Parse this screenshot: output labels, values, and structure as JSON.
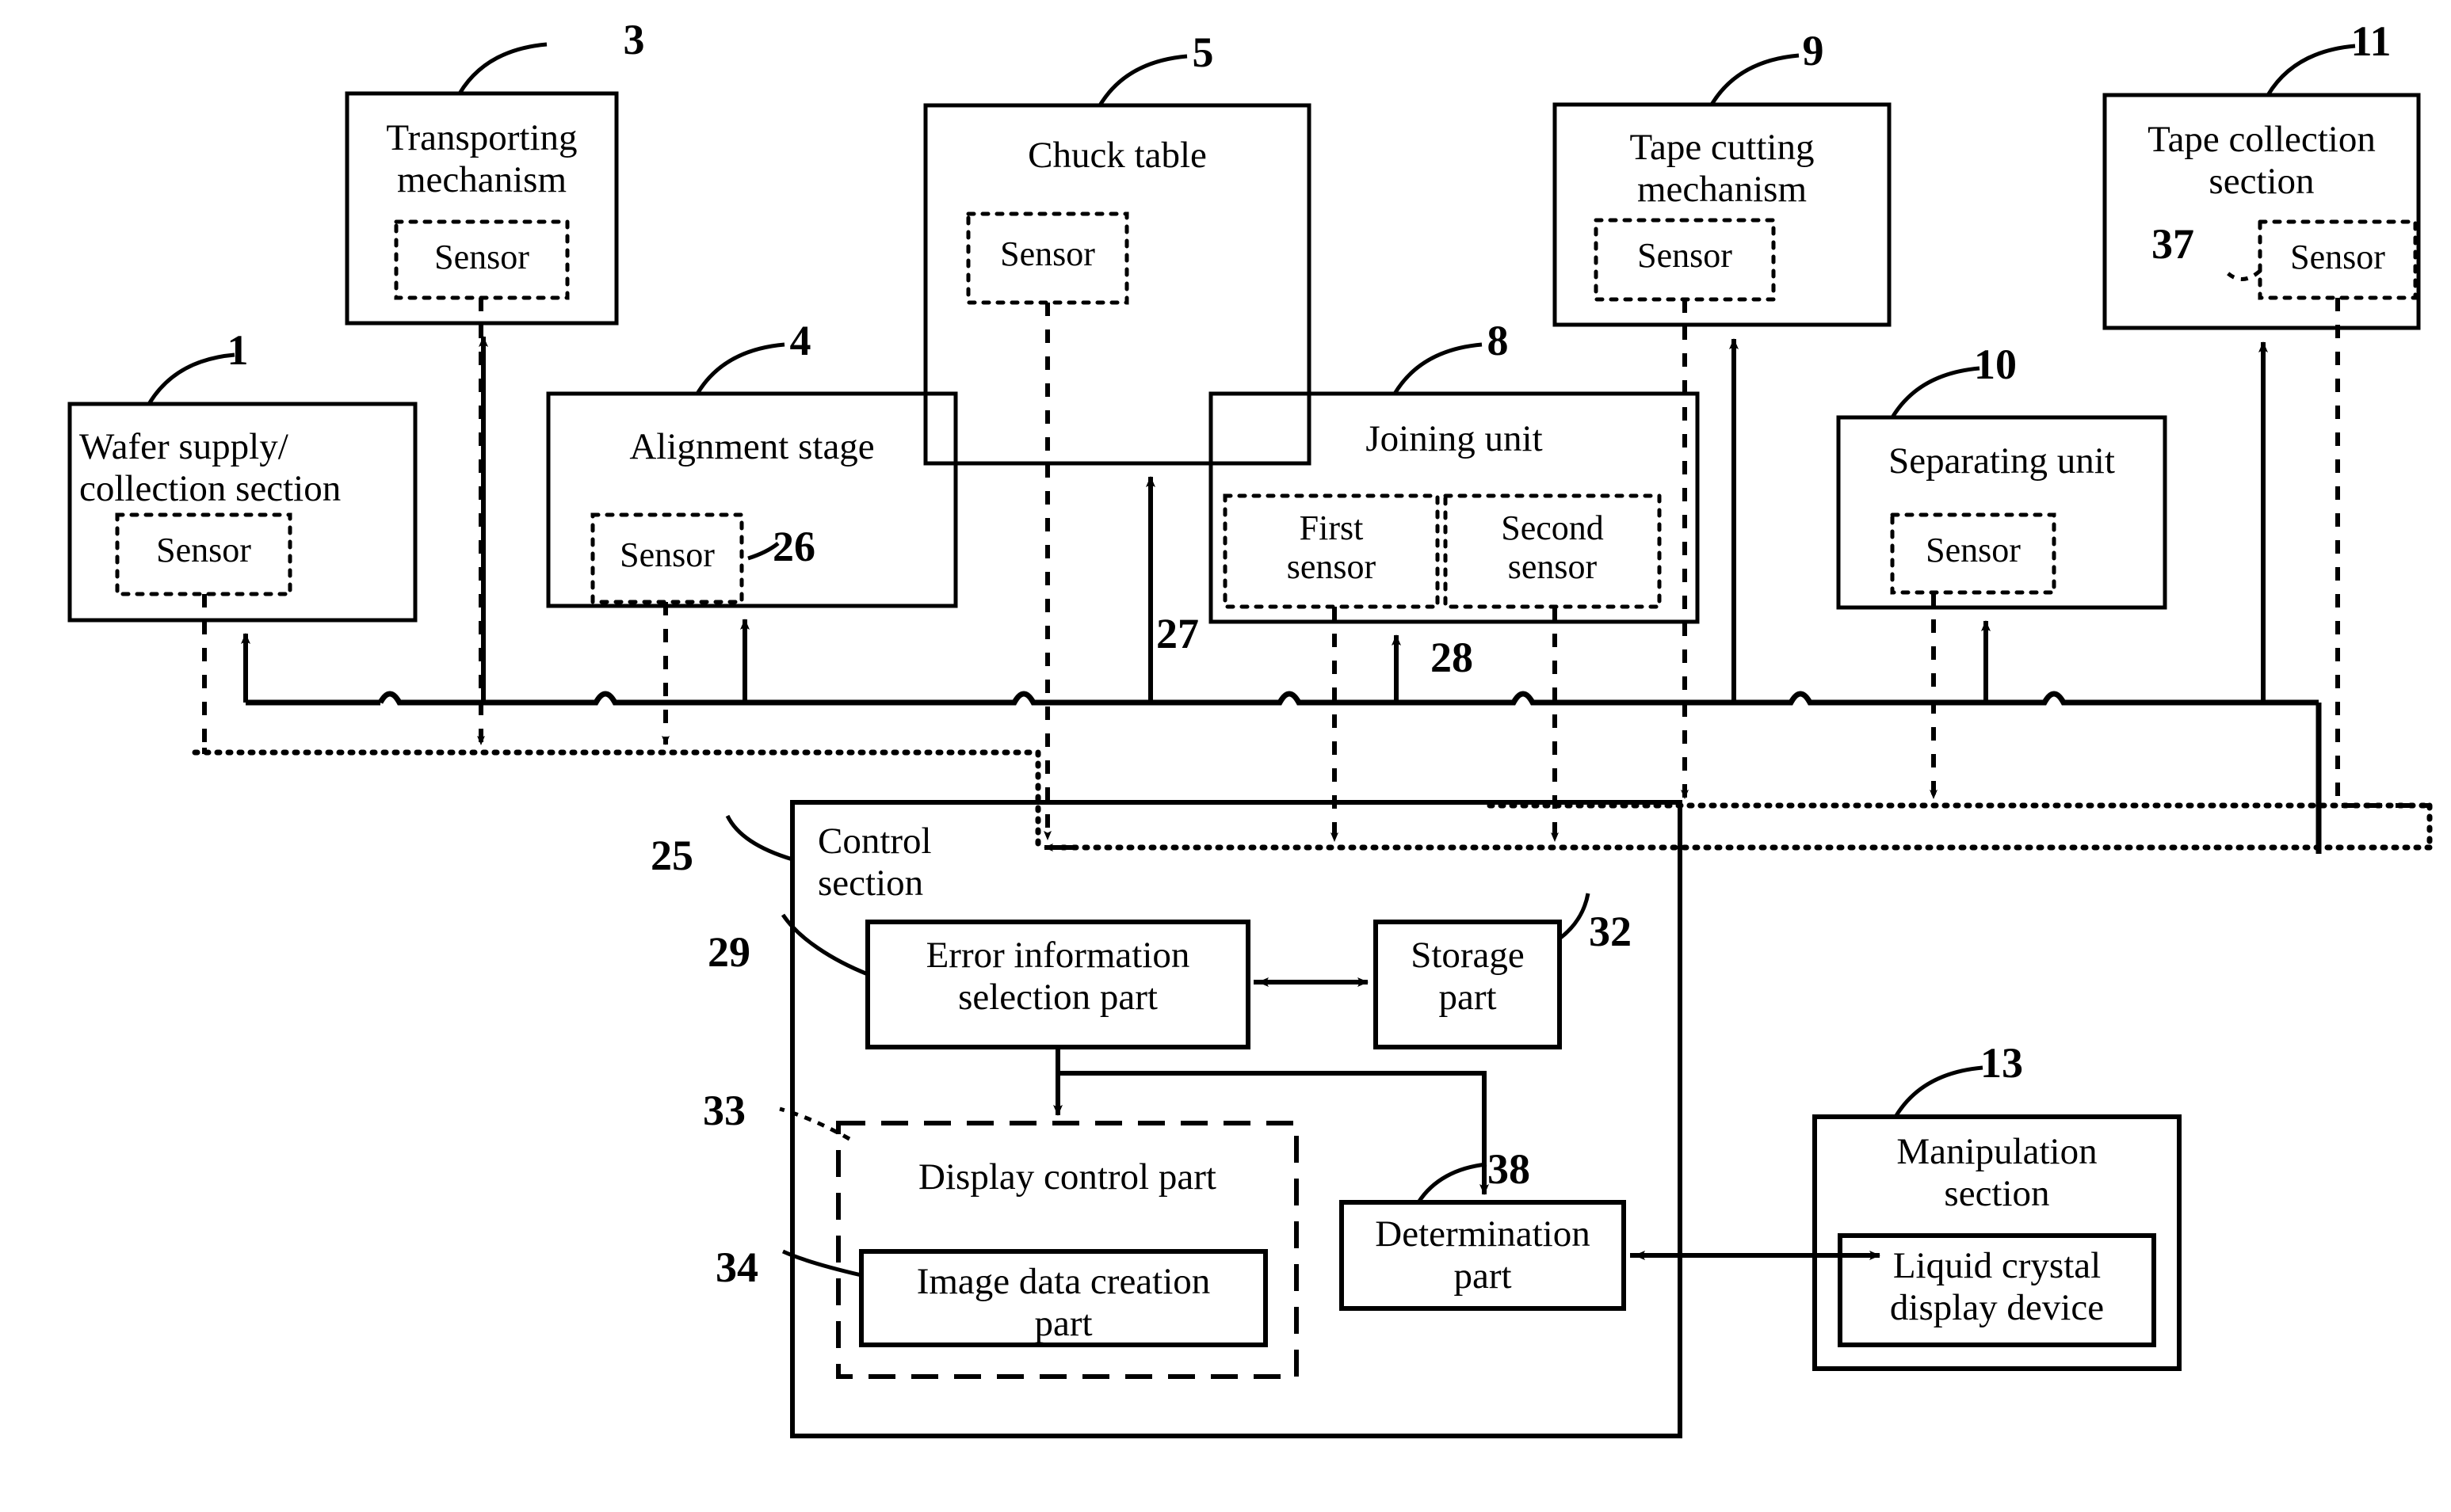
{
  "figure": {
    "type": "patent-block-diagram",
    "description": "Semiconductor wafer tape joining apparatus control block diagram"
  },
  "blocks": {
    "wafer_supply": {
      "label_line1": "Wafer supply/",
      "label_line2": "collection section",
      "numeral": "1",
      "sensor": "Sensor"
    },
    "transporting": {
      "label_line1": "Transporting",
      "label_line2": "mechanism",
      "numeral": "3",
      "sensor": "Sensor"
    },
    "alignment": {
      "label_line1": "Alignment stage",
      "numeral": "4",
      "sensor": "Sensor",
      "sensor_numeral": "26"
    },
    "chuck_table": {
      "label_line1": "Chuck table",
      "numeral": "5",
      "sensor": "Sensor"
    },
    "joining_unit": {
      "label_line1": "Joining unit",
      "numeral": "8",
      "first_sensor_line1": "First",
      "first_sensor_line2": "sensor",
      "first_sensor_numeral": "27",
      "second_sensor_line1": "Second",
      "second_sensor_line2": "sensor",
      "second_sensor_numeral": "28"
    },
    "tape_cutting": {
      "label_line1": "Tape cutting",
      "label_line2": "mechanism",
      "numeral": "9",
      "sensor": "Sensor"
    },
    "separating": {
      "label_line1": "Separating unit",
      "numeral": "10",
      "sensor": "Sensor"
    },
    "tape_collection": {
      "label_line1": "Tape collection",
      "label_line2": "section",
      "numeral": "11",
      "sensor": "Sensor",
      "sensor_numeral": "37"
    },
    "control_section": {
      "label_line1": "Control",
      "label_line2": "section",
      "numeral": "25"
    },
    "error_info": {
      "label_line1": "Error information",
      "label_line2": "selection part",
      "numeral": "29"
    },
    "storage": {
      "label_line1": "Storage",
      "label_line2": "part",
      "numeral": "32"
    },
    "display_control": {
      "label_line1": "Display control part",
      "numeral": "33"
    },
    "image_data": {
      "label_line1": "Image data creation",
      "label_line2": "part",
      "numeral": "34"
    },
    "determination": {
      "label_line1": "Determination",
      "label_line2": "part",
      "numeral": "38"
    },
    "manipulation": {
      "label_line1": "Manipulation",
      "label_line2": "section",
      "numeral": "13"
    },
    "lcd": {
      "label_line1": "Liquid crystal",
      "label_line2": "display device"
    }
  },
  "colors": {
    "line": "#000000",
    "background": "#ffffff"
  }
}
